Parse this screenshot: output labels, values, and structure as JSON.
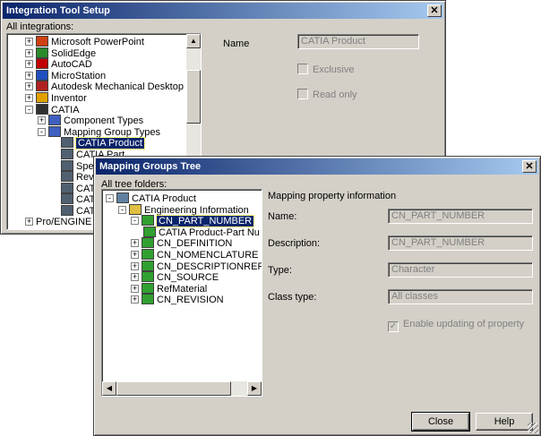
{
  "back_window": {
    "title": "Integration Tool Setup",
    "all_integrations_label": "All integrations:",
    "tree": [
      {
        "label": "Microsoft PowerPoint",
        "expander": "+",
        "icon": "ppt-icon"
      },
      {
        "label": "SolidEdge",
        "expander": "+",
        "icon": "solidedge-icon"
      },
      {
        "label": "AutoCAD",
        "expander": "+",
        "icon": "autocad-icon"
      },
      {
        "label": "MicroStation",
        "expander": "+",
        "icon": "microstation-icon"
      },
      {
        "label": "Autodesk Mechanical Desktop",
        "expander": "+",
        "icon": "mdt-icon"
      },
      {
        "label": "Inventor",
        "expander": "+",
        "icon": "inventor-icon"
      },
      {
        "label": "CATIA",
        "expander": "-",
        "icon": "catia-icon"
      },
      {
        "label": "Component Types",
        "expander": "+",
        "icon": "tree-node-icon"
      },
      {
        "label": "Mapping Group Types",
        "expander": "-",
        "icon": "tree-node-icon"
      },
      {
        "label": "CATIA Product",
        "icon": "mapping-group-icon",
        "selected": true
      },
      {
        "label": "CATIA Part",
        "icon": "mapping-group-icon"
      },
      {
        "label": "Spec",
        "icon": "mapping-group-icon"
      },
      {
        "label": "Revi",
        "icon": "mapping-group-icon"
      },
      {
        "label": "CATI",
        "icon": "mapping-group-icon"
      },
      {
        "label": "CATI",
        "icon": "mapping-group-icon"
      },
      {
        "label": "CATI",
        "icon": "mapping-group-icon"
      },
      {
        "label": "Pro/ENGINE",
        "expander": "+",
        "icon": ""
      }
    ],
    "name_label": "Name",
    "name_value": "CATIA Product",
    "exclusive_label": "Exclusive",
    "readonly_label": "Read only"
  },
  "front_window": {
    "title": "Mapping Groups Tree",
    "all_tree_folders_label": "All tree folders:",
    "tree": [
      {
        "label": "CATIA Product",
        "expander": "-"
      },
      {
        "label": "Engineering Information",
        "expander": "-"
      },
      {
        "label": "CN_PART_NUMBER",
        "expander": "-",
        "selected": true
      },
      {
        "label": "CATIA Product-Part Nu",
        "expander": ""
      },
      {
        "label": "CN_DEFINITION",
        "expander": "+"
      },
      {
        "label": "CN_NOMENCLATURE",
        "expander": "+"
      },
      {
        "label": "CN_DESCRIPTIONREF",
        "expander": "+"
      },
      {
        "label": "CN_SOURCE",
        "expander": "+"
      },
      {
        "label": "RefMaterial",
        "expander": "+"
      },
      {
        "label": "CN_REVISION",
        "expander": "+"
      }
    ],
    "section_title": "Mapping property information",
    "name_label": "Name:",
    "name_value": "CN_PART_NUMBER",
    "description_label": "Description:",
    "description_value": "CN_PART_NUMBER",
    "type_label": "Type:",
    "type_value": "Character",
    "class_type_label": "Class type:",
    "class_type_value": "All classes",
    "enable_updating_label": "Enable updating of property",
    "close_label": "Close",
    "help_label": "Help"
  }
}
